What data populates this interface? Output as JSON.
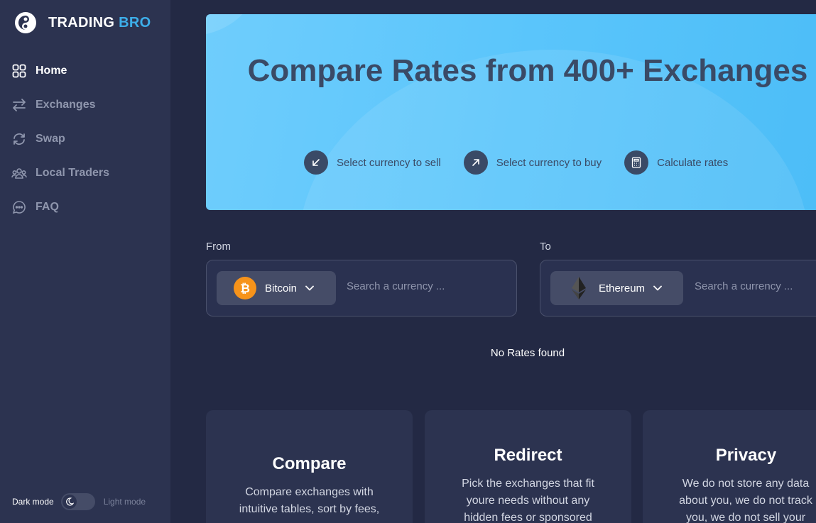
{
  "brand": {
    "name_main": "TRADING",
    "name_accent": "BRO"
  },
  "nav": [
    {
      "label": "Home",
      "icon": "grid-icon",
      "active": true
    },
    {
      "label": "Exchanges",
      "icon": "arrows-swap-icon"
    },
    {
      "label": "Swap",
      "icon": "refresh-icon"
    },
    {
      "label": "Local Traders",
      "icon": "users-icon"
    },
    {
      "label": "FAQ",
      "icon": "chat-icon"
    }
  ],
  "mode": {
    "dark_label": "Dark mode",
    "light_label": "Light mode"
  },
  "hero": {
    "title": "Compare Rates from 400+ Exchanges",
    "steps": [
      {
        "label": "Select currency to sell",
        "icon": "arrow-down-left-icon"
      },
      {
        "label": "Select currency to buy",
        "icon": "arrow-up-right-icon"
      },
      {
        "label": "Calculate rates",
        "icon": "calculator-icon"
      }
    ]
  },
  "from": {
    "label": "From",
    "currency": "Bitcoin",
    "placeholder": "Search a currency ..."
  },
  "to": {
    "label": "To",
    "currency": "Ethereum",
    "placeholder": "Search a currency ..."
  },
  "results": {
    "empty_text": "No Rates found"
  },
  "cards": [
    {
      "title": "Compare",
      "text": "Compare exchanges with intuitive tables, sort by fees,"
    },
    {
      "title": "Redirect",
      "text": "Pick the exchanges that fit youre needs without any hidden fees or sponsored"
    },
    {
      "title": "Privacy",
      "text": "We do not store any data about you, we do not track you, we do not sell your"
    }
  ],
  "colors": {
    "sidebar": "#2c3350",
    "background": "#232944",
    "accent": "#3daee9",
    "hero_text": "#3a4a66",
    "bitcoin": "#f7931a"
  }
}
